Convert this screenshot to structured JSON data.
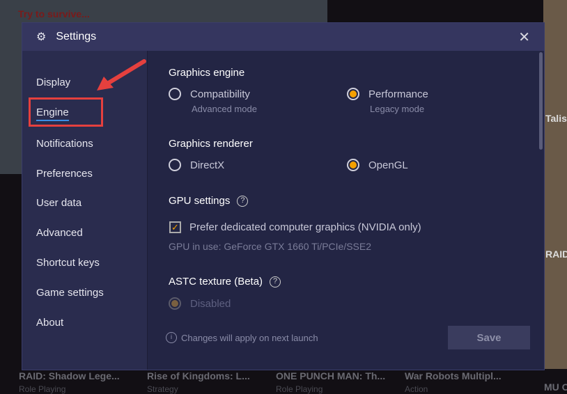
{
  "background": {
    "banner": "Try to survive...",
    "side_titles": [
      "Talis",
      "RAID"
    ],
    "games": [
      {
        "title": "RAID: Shadow Lege...",
        "genre": "Role Playing"
      },
      {
        "title": "Rise of Kingdoms: L...",
        "genre": "Strategy"
      },
      {
        "title": "ONE PUNCH MAN: Th...",
        "genre": "Role Playing"
      },
      {
        "title": "War Robots Multipl...",
        "genre": "Action"
      },
      {
        "title": "MU O",
        "genre": ""
      }
    ]
  },
  "dialog": {
    "title": "Settings",
    "close": "✕",
    "gear": "⚙"
  },
  "sidebar": {
    "items": [
      "Display",
      "Engine",
      "Notifications",
      "Preferences",
      "User data",
      "Advanced",
      "Shortcut keys",
      "Game settings",
      "About"
    ],
    "active": "Engine"
  },
  "engine": {
    "graphics_engine": {
      "label": "Graphics engine",
      "options": [
        {
          "label": "Compatibility",
          "sub": "Advanced mode",
          "selected": false
        },
        {
          "label": "Performance",
          "sub": "Legacy mode",
          "selected": true
        }
      ]
    },
    "graphics_renderer": {
      "label": "Graphics renderer",
      "options": [
        {
          "label": "DirectX",
          "selected": false
        },
        {
          "label": "OpenGL",
          "selected": true
        }
      ]
    },
    "gpu": {
      "label": "GPU settings",
      "help": "?",
      "checkbox": "Prefer dedicated computer graphics (NVIDIA only)",
      "checked": true,
      "in_use": "GPU in use: GeForce GTX 1660 Ti/PCIe/SSE2"
    },
    "astc": {
      "label": "ASTC texture (Beta)",
      "help": "?",
      "option": "Disabled"
    },
    "note": "Changes will apply on next launch",
    "info_icon": "i",
    "save": "Save"
  },
  "colors": {
    "accent": "#f4a000",
    "highlight": "#e5403e",
    "underline": "#3a8ee6"
  }
}
